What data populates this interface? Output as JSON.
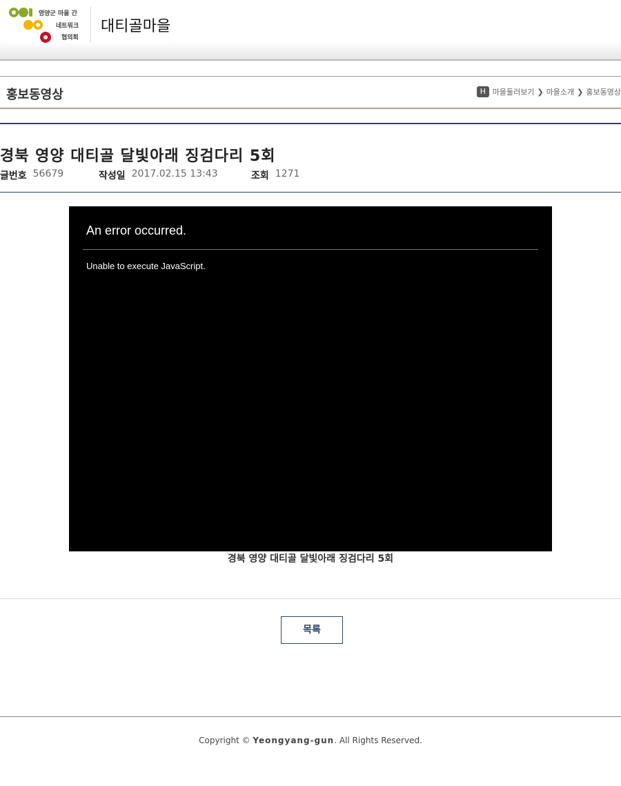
{
  "header": {
    "logo_text": [
      "영양군 마을 간",
      "네트워크",
      "협의회"
    ],
    "site_title": "대티골마을"
  },
  "subbar": {
    "page_title": "홍보동영상",
    "home_icon_label": "H",
    "breadcrumb": [
      "마을둘러보기",
      "마을소개",
      "홍보동영상"
    ]
  },
  "post": {
    "title": "경북 영양 대티골 달빛아래 징검다리 5회",
    "number_label": "글번호",
    "number_value": "56679",
    "date_label": "작성일",
    "date_value": "2017.02.15 13:43",
    "views_label": "조회",
    "views_value": "1271"
  },
  "video": {
    "error_title": "An error occurred.",
    "error_message": "Unable to execute JavaScript.",
    "caption": "경북 영양 대티골 달빛아래 징검다리 5회"
  },
  "actions": {
    "list_button": "목록"
  },
  "footer": {
    "copyright_prefix": "Copyright ©",
    "brand": "Yeongyang-gun",
    "copyright_suffix": ". All Rights Reserved."
  },
  "colors": {
    "accent": "#2b4560",
    "logo_green": "#8aa82a",
    "logo_yellow": "#f2b500",
    "logo_red": "#c8102e"
  }
}
